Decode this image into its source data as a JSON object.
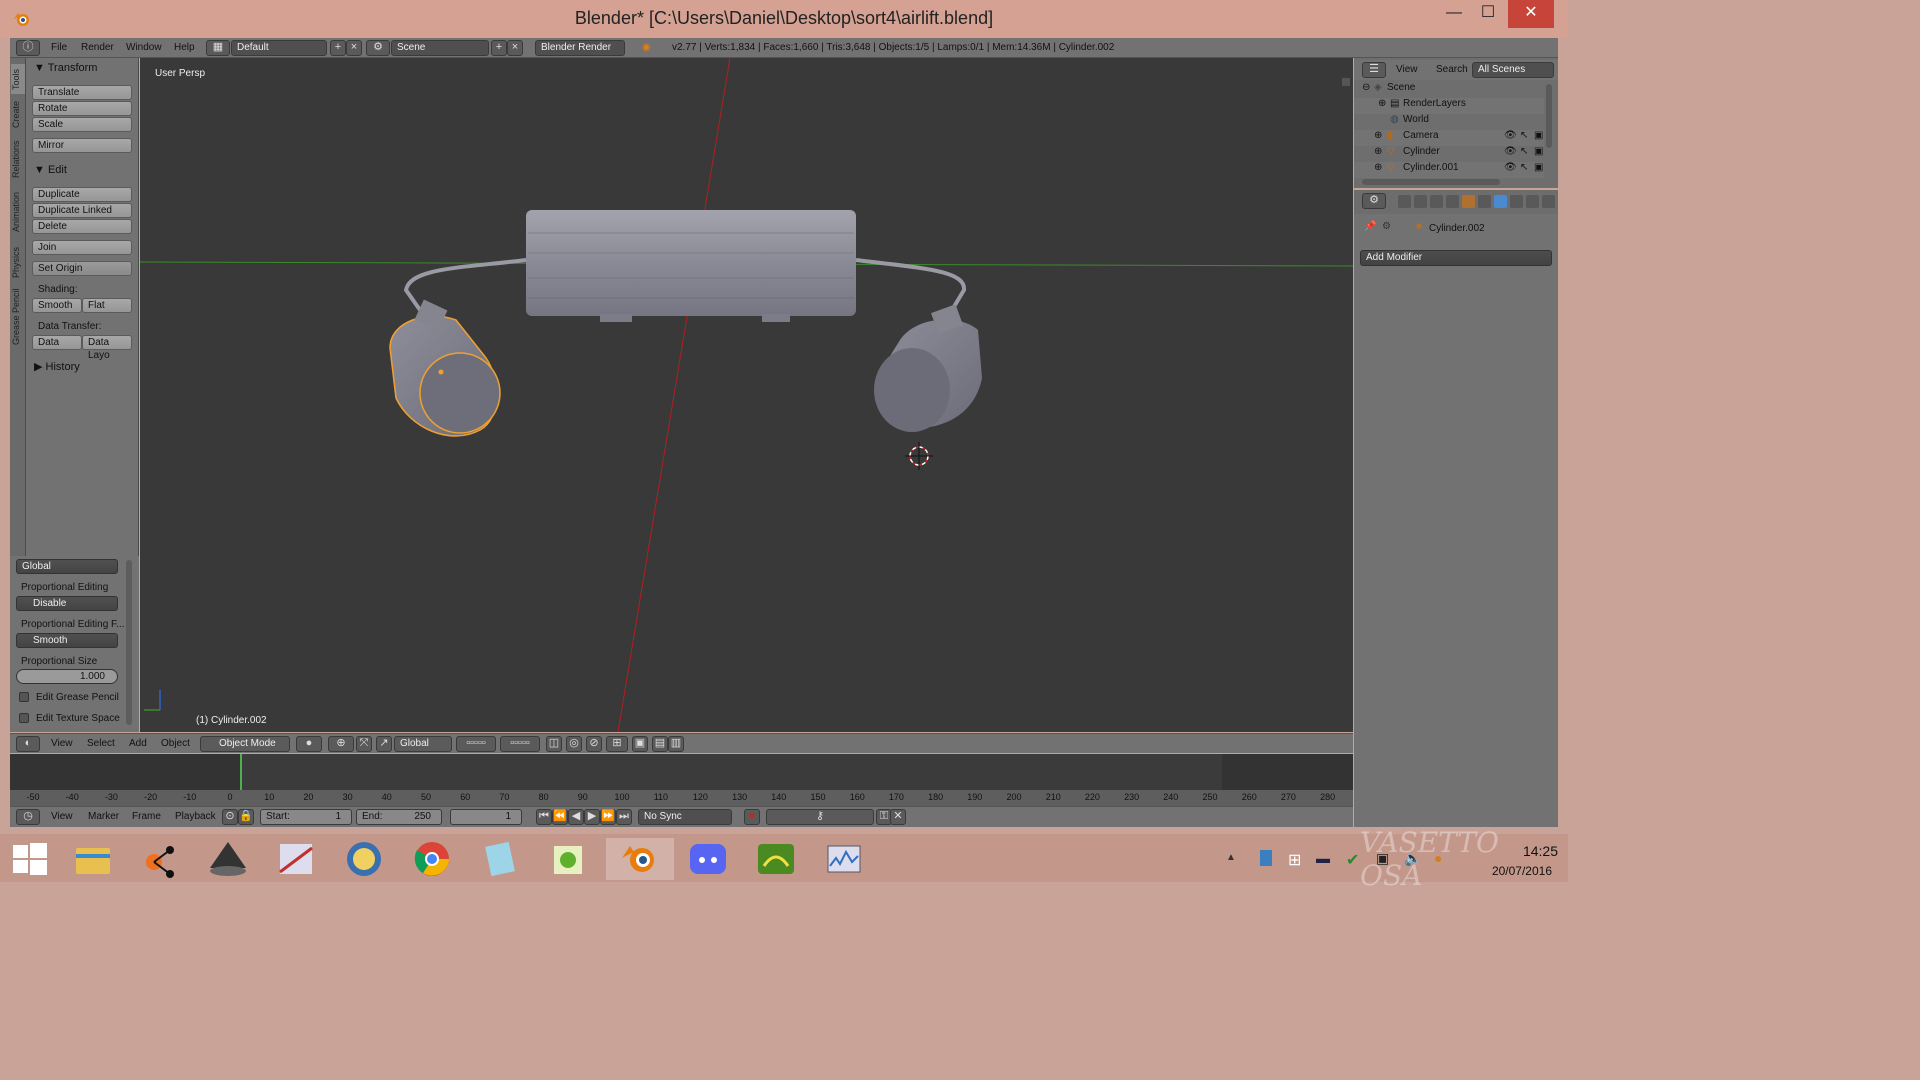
{
  "window": {
    "title": "Blender* [C:\\Users\\Daniel\\Desktop\\sort4\\airlift.blend]",
    "minimize": "—",
    "maximize": "☐",
    "close": "✕"
  },
  "info_header": {
    "menus": [
      "File",
      "Render",
      "Window",
      "Help"
    ],
    "layout": "Default",
    "scene": "Scene",
    "engine": "Blender Render",
    "stats": "v2.77 | Verts:1,834 | Faces:1,660 | Tris:3,648 | Objects:1/5 | Lamps:0/1 | Mem:14.36M | Cylinder.002"
  },
  "tool_tabs": [
    "Tools",
    "Create",
    "Relations",
    "Animation",
    "Physics",
    "Grease Pencil"
  ],
  "toolshelf": {
    "transform_header": "Transform",
    "transform_buttons": [
      "Translate",
      "Rotate",
      "Scale"
    ],
    "mirror": "Mirror",
    "edit_header": "Edit",
    "edit_buttons": [
      "Duplicate",
      "Duplicate Linked",
      "Delete"
    ],
    "join": "Join",
    "set_origin": "Set Origin",
    "shading_label": "Shading:",
    "smooth": "Smooth",
    "flat": "Flat",
    "data_transfer_label": "Data Transfer:",
    "data": "Data",
    "data_layo": "Data Layo",
    "history_header": "History"
  },
  "tool_props": {
    "orientation": "Global",
    "prop_edit_label": "Proportional Editing",
    "prop_edit_value": "Disable",
    "prop_falloff_label": "Proportional Editing F...",
    "prop_falloff_value": "Smooth",
    "prop_size_label": "Proportional Size",
    "prop_size_value": "1.000",
    "edit_grease_pencil": "Edit Grease Pencil",
    "edit_texture_space": "Edit Texture Space"
  },
  "viewport": {
    "view_label": "User Persp",
    "object_label": "(1) Cylinder.002"
  },
  "view3d_header": {
    "menus": [
      "View",
      "Select",
      "Add",
      "Object"
    ],
    "mode": "Object Mode",
    "orientation": "Global"
  },
  "timeline": {
    "ticks": [
      "-50",
      "-40",
      "-30",
      "-20",
      "-10",
      "0",
      "10",
      "20",
      "30",
      "40",
      "50",
      "60",
      "70",
      "80",
      "90",
      "100",
      "110",
      "120",
      "130",
      "140",
      "150",
      "160",
      "170",
      "180",
      "190",
      "200",
      "210",
      "220",
      "230",
      "240",
      "250",
      "260",
      "270",
      "280"
    ],
    "menus": [
      "View",
      "Marker",
      "Frame",
      "Playback"
    ],
    "start_label": "Start:",
    "start_value": "1",
    "end_label": "End:",
    "end_value": "250",
    "current_frame": "1",
    "sync": "No Sync"
  },
  "outliner": {
    "menus": [
      "View",
      "Search"
    ],
    "filter": "All Scenes",
    "rows": [
      "Scene",
      "RenderLayers",
      "World",
      "Camera",
      "Cylinder",
      "Cylinder.001"
    ]
  },
  "properties": {
    "object_name": "Cylinder.002",
    "add_modifier": "Add Modifier"
  },
  "taskbar": {
    "time": "14:25",
    "date": "20/07/2016",
    "watermark": "VASETTO OSA"
  },
  "colors": {
    "selection_outline": "#f0a030",
    "x_axis": "#b02020",
    "y_axis": "#3a8a2a",
    "viewport_bg": "#393939",
    "panel_bg": "#727272"
  }
}
